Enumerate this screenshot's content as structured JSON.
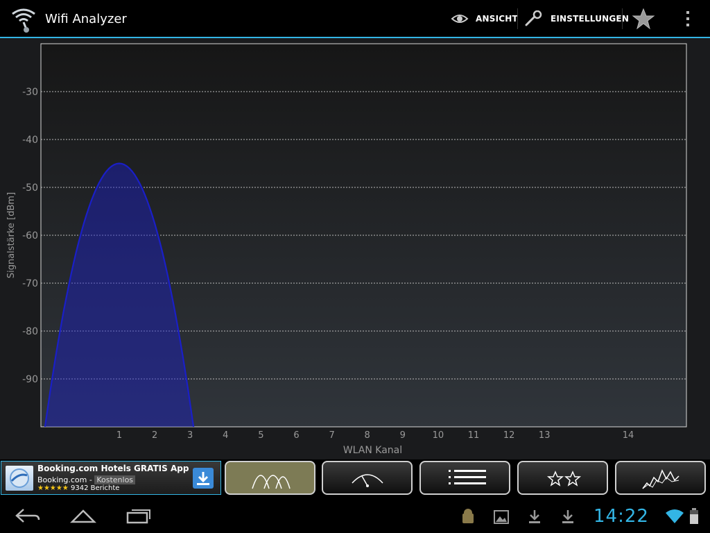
{
  "app": {
    "title": "Wifi Analyzer"
  },
  "actionbar": {
    "view_label": "ANSICHT",
    "settings_label": "EINSTELLUNGEN",
    "accent_color": "#33b5e5"
  },
  "ad": {
    "title": "Booking.com Hotels GRATIS App",
    "publisher": "Booking.com -",
    "price_badge": "Kostenlos",
    "stars": "★★★★★",
    "reviews": "9342 Berichte"
  },
  "tabs": [
    {
      "icon": "channel-graph-icon",
      "active": true
    },
    {
      "icon": "signal-meter-icon",
      "active": false
    },
    {
      "icon": "ap-list-icon",
      "active": false
    },
    {
      "icon": "channel-rating-icon",
      "active": false
    },
    {
      "icon": "time-graph-icon",
      "active": false
    }
  ],
  "status": {
    "time": "14:22"
  },
  "chart_data": {
    "type": "area",
    "xlabel": "WLAN Kanal",
    "ylabel": "Signalstärke [dBm]",
    "ylim": [
      -100,
      -20
    ],
    "yticks": [
      -30,
      -40,
      -50,
      -60,
      -70,
      -80,
      -90
    ],
    "ytick_labels": [
      "-30",
      "-40",
      "-50",
      "-60",
      "-70",
      "-80",
      "-90"
    ],
    "xticks": [
      1,
      2,
      3,
      4,
      5,
      6,
      7,
      8,
      9,
      10,
      11,
      12,
      13,
      14
    ],
    "xtick_labels": [
      "1",
      "2",
      "3",
      "4",
      "5",
      "6",
      "7",
      "8",
      "9",
      "10",
      "11",
      "12",
      "13",
      "14"
    ],
    "grid": true,
    "series": [
      {
        "channel": 1,
        "peak_dbm": -45,
        "half_width_channels": 2.15,
        "color": "#1a1fc7"
      }
    ]
  }
}
